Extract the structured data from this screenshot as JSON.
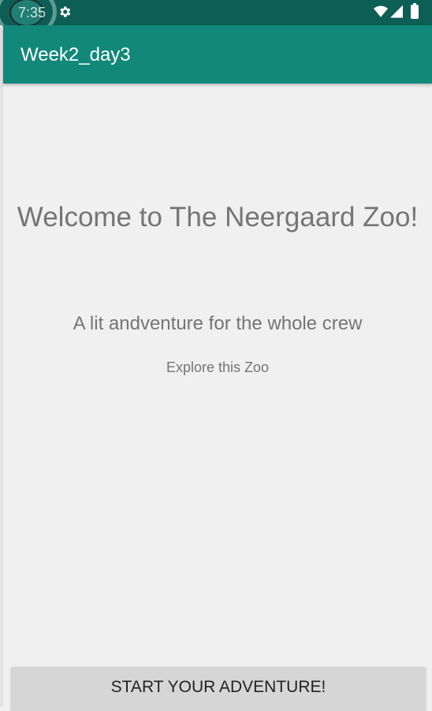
{
  "status_bar": {
    "time": "7:35",
    "icons": [
      "gear-icon",
      "wifi-icon",
      "signal-icon",
      "battery-icon"
    ]
  },
  "app_bar": {
    "title": "Week2_day3",
    "color": "#11887a"
  },
  "main": {
    "welcome": "Welcome to The Neergaard Zoo!",
    "tagline": "A lit andventure for the whole crew",
    "explore": "Explore this Zoo"
  },
  "actions": {
    "start_label": "START YOUR ADVENTURE!"
  },
  "colors": {
    "status_bar": "#0d5e54",
    "background": "#f0f0f0",
    "text_secondary": "#757575",
    "button": "#d6d6d6"
  }
}
